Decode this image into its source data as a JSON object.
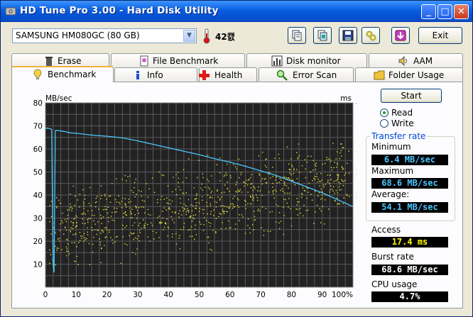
{
  "window": {
    "title": "HD Tune Pro 3.00 - Hard Disk Utility",
    "min_glyph": "_",
    "max_glyph": "□",
    "close_glyph": "✕"
  },
  "toolbar": {
    "drive": "SAMSUNG HM080GC (80 GB)",
    "temperature": "42캜",
    "exit_label": "Exit",
    "icons": [
      "copy-text-icon",
      "copy-screenshot-icon",
      "save-icon",
      "options-icon",
      "download-icon"
    ]
  },
  "tabs": {
    "top_row": [
      {
        "label": "Erase",
        "icon": "trash-icon"
      },
      {
        "label": "File Benchmark",
        "icon": "file-icon"
      },
      {
        "label": "Disk monitor",
        "icon": "bar-chart-icon"
      },
      {
        "label": "AAM",
        "icon": "speaker-icon"
      }
    ],
    "bottom_row": [
      {
        "label": "Benchmark",
        "icon": "bulb-icon",
        "active": true
      },
      {
        "label": "Info",
        "icon": "info-icon"
      },
      {
        "label": "Health",
        "icon": "cross-icon"
      },
      {
        "label": "Error Scan",
        "icon": "magnifier-icon"
      },
      {
        "label": "Folder Usage",
        "icon": "folder-icon"
      }
    ]
  },
  "benchmark": {
    "start_label": "Start",
    "read_label": "Read",
    "write_label": "Write",
    "mode": "Read",
    "transfer_rate_title": "Transfer rate",
    "minimum_label": "Minimum",
    "minimum_value": "6.4 MB/sec",
    "maximum_label": "Maximum",
    "maximum_value": "68.6 MB/sec",
    "average_label": "Average:",
    "average_value": "54.1 MB/sec",
    "access_label": "Access",
    "access_value": "17.4 ms",
    "burst_label": "Burst rate",
    "burst_value": "68.6 MB/sec",
    "cpu_label": "CPU usage",
    "cpu_value": "4.7%"
  },
  "chart_data": {
    "type": "line",
    "title": "",
    "ylabel": "MB/sec",
    "y2label": "ms",
    "ylim": [
      0,
      80
    ],
    "y2lim": [
      0,
      40
    ],
    "yticks": [
      10,
      20,
      30,
      40,
      50,
      60,
      70,
      80
    ],
    "y2ticks": [
      5,
      10,
      15,
      20,
      25,
      30,
      35,
      40
    ],
    "xticks": [
      "0",
      "10",
      "20",
      "30",
      "40",
      "50",
      "60",
      "70",
      "80",
      "90",
      "100%"
    ],
    "xlim": [
      0,
      100
    ],
    "grid": true,
    "colors": {
      "background": "#222222",
      "grid": "#5a5a5a",
      "transfer": "#4cc6ff",
      "access": "#e3e33a"
    },
    "series": [
      {
        "x": [
          0,
          1,
          2,
          2.5,
          2.8,
          3.2,
          4,
          6,
          8,
          10,
          12,
          15,
          20,
          25,
          30,
          35,
          40,
          45,
          50,
          55,
          60,
          65,
          70,
          75,
          80,
          85,
          90,
          95,
          100
        ],
        "values": [
          69,
          69,
          68.5,
          10,
          6.4,
          68,
          68,
          67.6,
          67,
          66.8,
          66.5,
          66,
          65.5,
          64.8,
          63.5,
          62,
          60.5,
          59,
          57.5,
          55.8,
          54.2,
          52.5,
          50.5,
          48.5,
          46,
          43.5,
          41,
          38,
          35
        ]
      }
    ],
    "access_scatter": {
      "count": 900,
      "range_ms": [
        5,
        32
      ],
      "center_start_ms": 12,
      "center_end_ms": 24
    }
  }
}
